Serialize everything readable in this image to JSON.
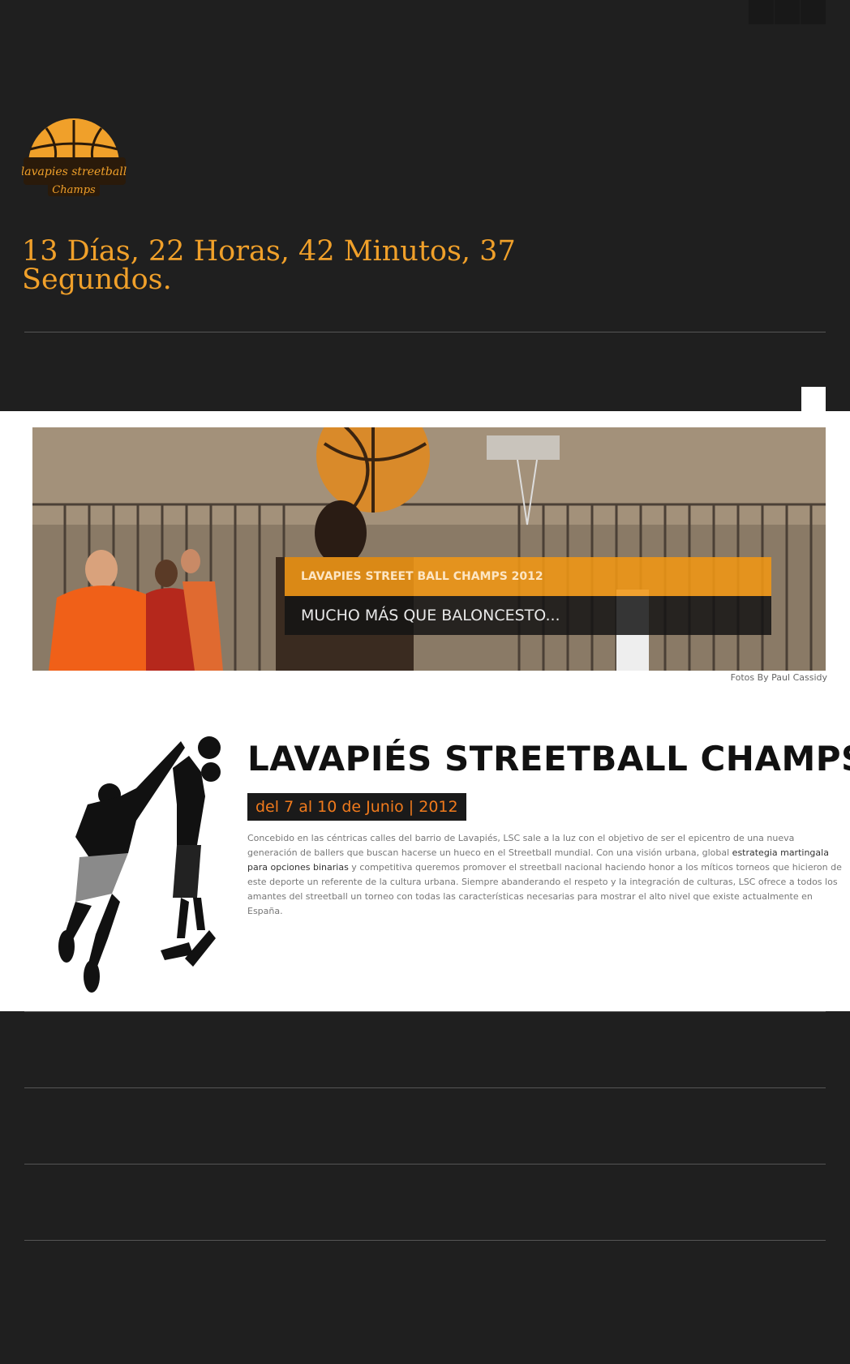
{
  "top_bar": {
    "buttons": [
      "",
      "",
      ""
    ]
  },
  "logo": {
    "text_line1": "lavapies streetball",
    "text_line2": "Champs"
  },
  "countdown": {
    "text": " 13 Días, 22 Horas, 42 Minutos, 37 Segundos."
  },
  "hero": {
    "caption_title": "LAVAPIES STREET BALL CHAMPS 2012",
    "caption_subtitle": "MUCHO MÁS QUE BALONCESTO...",
    "credit": "Fotos By Paul Cassidy"
  },
  "intro": {
    "headline": "LAVAPIÉS STREETBALL CHAMPS",
    "dates": "del 7 al 10 de Junio | 2012",
    "body_part1": "Concebido en las céntricas calles del barrio de Lavapiés, LSC sale a la luz con el objetivo de ser el epicentro de una nueva generación de ballers que buscan hacerse un hueco en el Streetball mundial. Con una visión urbana, global ",
    "body_link": "estrategia martingala para opciones binarias",
    "body_part2": " y competitiva queremos promover el streetball nacional haciendo honor a los míticos torneos que hicieron de este deporte un referente de la cultura urbana. Siempre abanderando el respeto y la integración de culturas, LSC ofrece a todos los amantes del streetball un torneo con todas las características necesarias para mostrar el alto nivel que existe actualmente en España."
  },
  "colors": {
    "background": "#1f1f1f",
    "accent": "#f0a02a",
    "orange": "#f07a1c"
  }
}
